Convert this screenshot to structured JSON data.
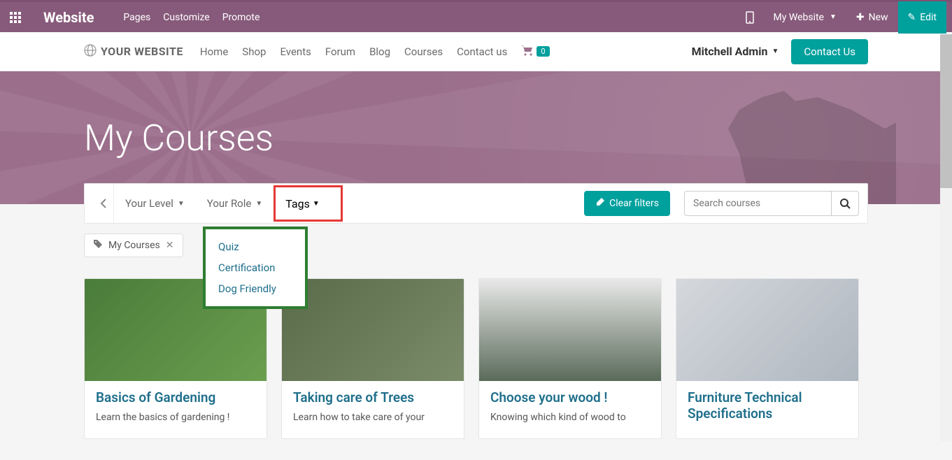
{
  "admin": {
    "brand": "Website",
    "menu": [
      "Pages",
      "Customize",
      "Promote"
    ],
    "my_website": "My Website",
    "new": "New",
    "edit": "Edit"
  },
  "site": {
    "logo_text": "YOUR WEBSITE",
    "nav": [
      "Home",
      "Shop",
      "Events",
      "Forum",
      "Blog",
      "Courses",
      "Contact us"
    ],
    "cart_count": "0",
    "user": "Mitchell Admin",
    "contact_btn": "Contact Us"
  },
  "hero": {
    "title": "My Courses"
  },
  "filters": {
    "your_level": "Your Level",
    "your_role": "Your Role",
    "tags": "Tags",
    "clear": "Clear filters",
    "search_placeholder": "Search courses",
    "tag_options": [
      "Quiz",
      "Certification",
      "Dog Friendly"
    ],
    "active_chip": "My Courses"
  },
  "courses": [
    {
      "title": "Basics of Gardening",
      "desc": "Learn the basics of gardening !"
    },
    {
      "title": "Taking care of Trees",
      "desc": "Learn how to take care of your"
    },
    {
      "title": "Choose your wood !",
      "desc": "Knowing which kind of wood to"
    },
    {
      "title": "Furniture Technical Specifications",
      "desc": ""
    }
  ]
}
